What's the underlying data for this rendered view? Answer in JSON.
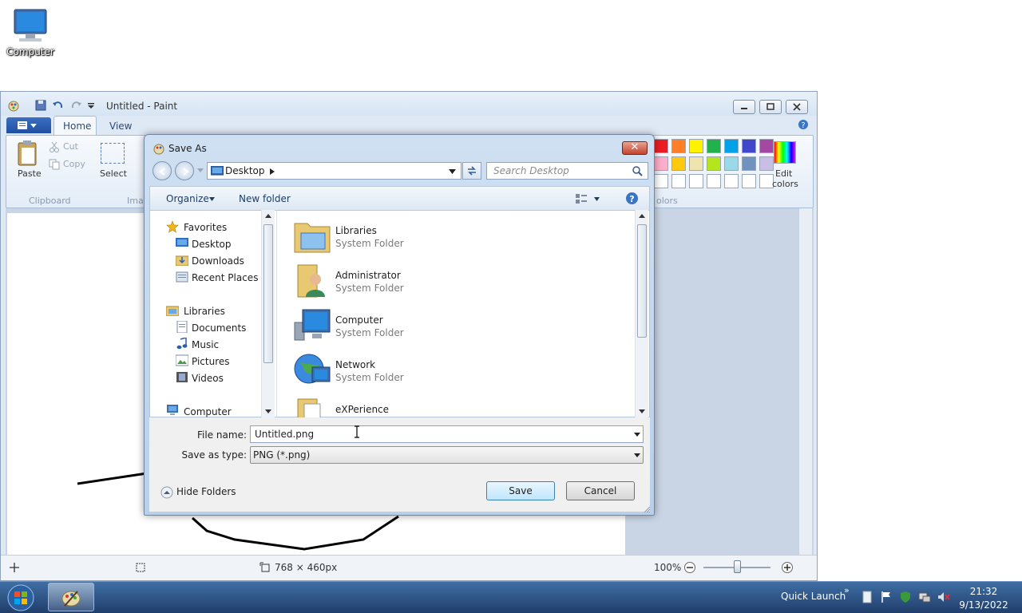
{
  "desktop": {
    "icon_label": "Computer"
  },
  "paint": {
    "title": "Untitled - Paint",
    "tabs": {
      "home": "Home",
      "view": "View"
    },
    "ribbon": {
      "paste": "Paste",
      "cut": "Cut",
      "copy": "Copy",
      "select": "Select",
      "clipboard_group": "Clipboard",
      "image_group_partial": "Imag",
      "colors_group_partial": "olors",
      "edit_colors_line1": "Edit",
      "edit_colors_line2": "colors"
    },
    "status": {
      "dimensions": "768 × 460px",
      "zoom": "100%"
    }
  },
  "palette": {
    "row1": [
      "#ed1c24",
      "#ff7f27",
      "#fff200",
      "#22b14c",
      "#00a2e8",
      "#3f48cc",
      "#a349a4"
    ],
    "row2": [
      "#ffaec9",
      "#ffc90e",
      "#efe4b0",
      "#b5e61d",
      "#99d9ea",
      "#7092be",
      "#c8bfe7"
    ]
  },
  "dialog": {
    "title": "Save As",
    "address": "Desktop",
    "search_placeholder": "Search Desktop",
    "organize": "Organize",
    "new_folder": "New folder",
    "nav": {
      "favorites": "Favorites",
      "desktop": "Desktop",
      "downloads": "Downloads",
      "recent": "Recent Places",
      "libraries": "Libraries",
      "documents": "Documents",
      "music": "Music",
      "pictures": "Pictures",
      "videos": "Videos",
      "computer": "Computer"
    },
    "items": [
      {
        "name": "Libraries",
        "type": "System Folder"
      },
      {
        "name": "Administrator",
        "type": "System Folder"
      },
      {
        "name": "Computer",
        "type": "System Folder"
      },
      {
        "name": "Network",
        "type": "System Folder"
      },
      {
        "name": "eXPerience",
        "type": ""
      }
    ],
    "file_name_label": "File name:",
    "file_name_value": "Untitled.png",
    "save_type_label": "Save as type:",
    "save_type_value": "PNG (*.png)",
    "hide_folders": "Hide Folders",
    "save": "Save",
    "cancel": "Cancel"
  },
  "taskbar": {
    "quick_launch": "Quick Launch",
    "time": "21:32",
    "date": "9/13/2022"
  }
}
